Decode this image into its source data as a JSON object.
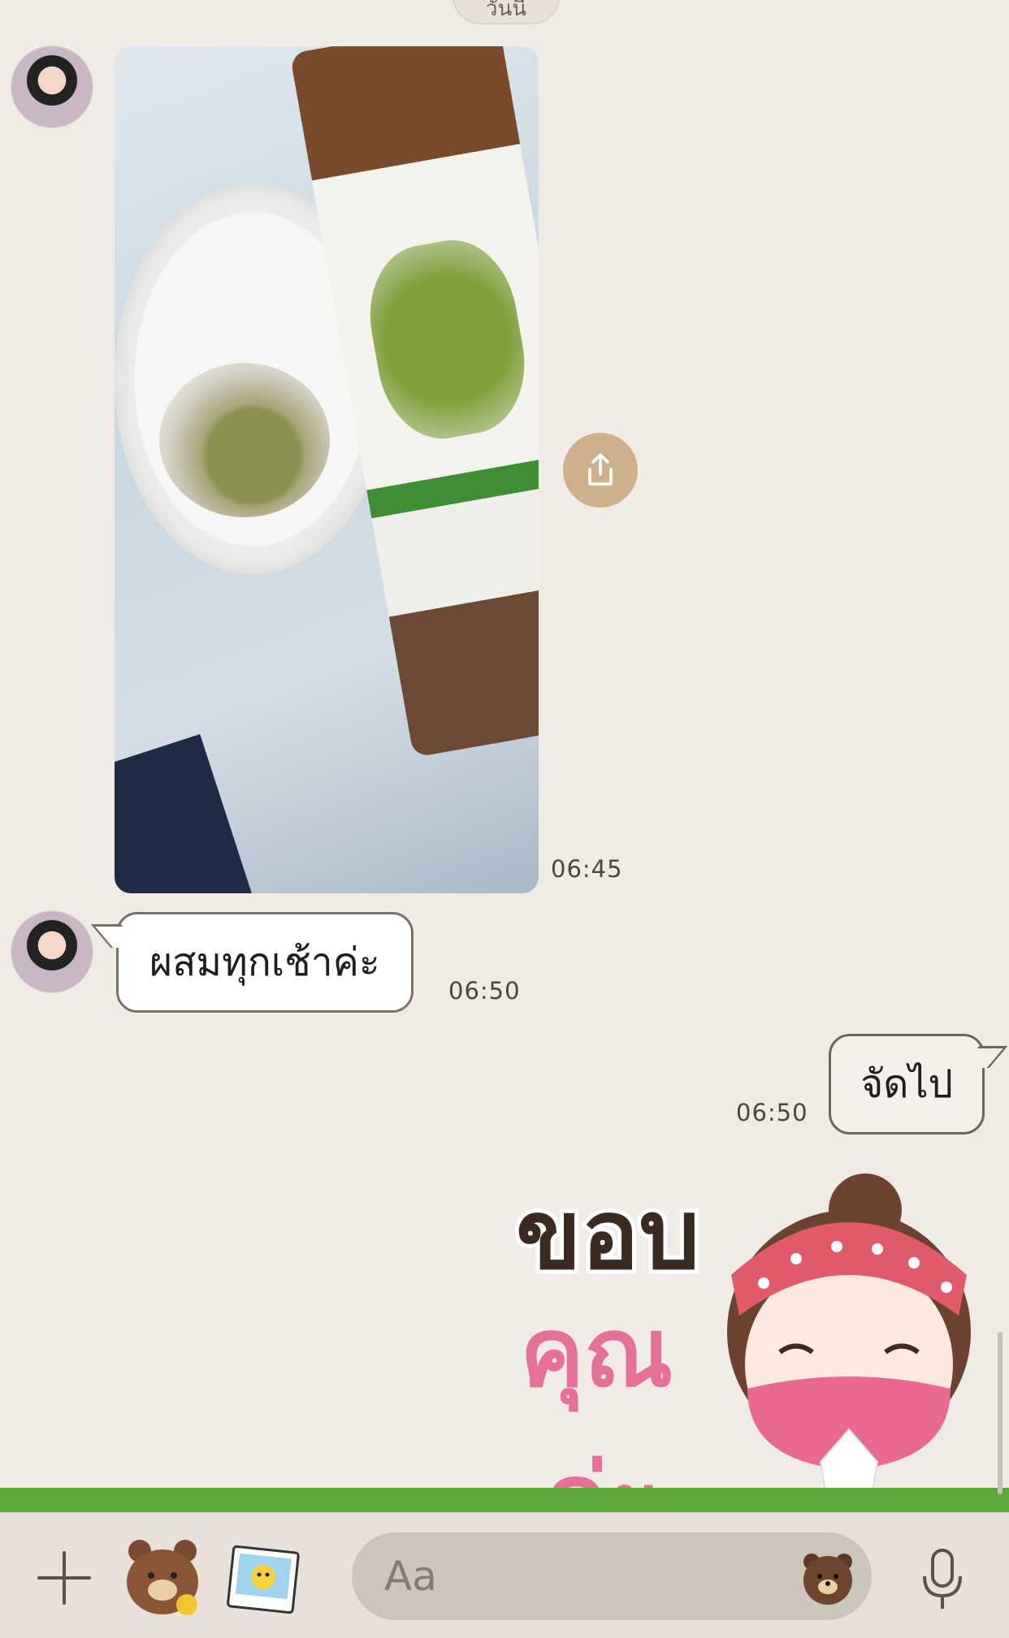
{
  "date_pill": "วันนี้",
  "messages": [
    {
      "type": "image",
      "direction": "incoming",
      "time": "06:45"
    },
    {
      "type": "text",
      "direction": "incoming",
      "text": "ผสมทุกเช้าค่ะ",
      "time": "06:50"
    },
    {
      "type": "text",
      "direction": "outgoing",
      "text": "จัดไป",
      "time": "06:50"
    },
    {
      "type": "sticker",
      "direction": "outgoing",
      "sticker_text": [
        "ขอบ",
        "คุณ",
        "ค่ะ"
      ]
    }
  ],
  "composer": {
    "placeholder": "Aa"
  },
  "colors": {
    "background": "#f0ebe5",
    "share_button": "#cdb08c",
    "sticker_pink": "#e66f97",
    "sticker_brown": "#3b2a22"
  }
}
